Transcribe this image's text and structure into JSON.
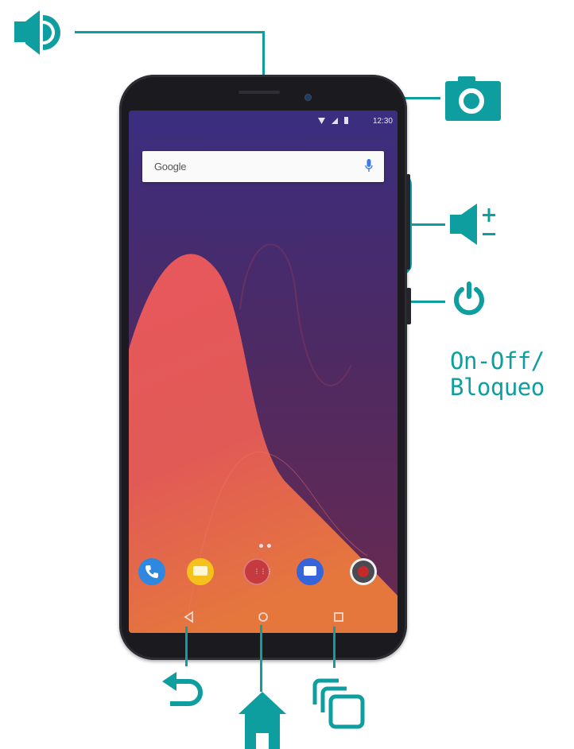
{
  "colors": {
    "accent": "#0f9ea0",
    "phone_body": "#1b1b1f",
    "wallpaper_coral": "#e0565a"
  },
  "labels": {
    "power_label": "On-Off/\nBloqueo"
  },
  "icons": {
    "earpiece": "speaker-icon",
    "front_camera": "camera-icon",
    "volume": "volume-icon",
    "power": "power-icon",
    "back": "back-arrow-icon",
    "home": "home-icon",
    "recents": "recent-apps-icon"
  },
  "phone_screen": {
    "status_time": "12:30",
    "search_brand": "Google",
    "dock_apps": [
      "phone-icon",
      "messages-icon",
      "app-drawer-icon",
      "email-icon",
      "camera-app-icon"
    ]
  }
}
